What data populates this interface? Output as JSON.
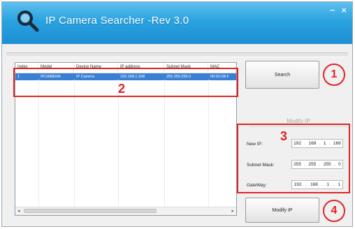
{
  "window": {
    "title": "IP Camera Searcher -Rev 3.0",
    "minimize_label": "−",
    "close_label": "×"
  },
  "list": {
    "columns": [
      "Index",
      "Model",
      "Device Name",
      "IP address",
      "Subnet Mask",
      "MAC"
    ],
    "rows": [
      [
        "1",
        "IPCAMERA",
        "IP Camera",
        "192.168.1.168",
        "255.255.255.0",
        "00:00:1B:F"
      ]
    ]
  },
  "search_button": "Search",
  "modify_group": {
    "title": "Modify IP",
    "new_ip_label": "New IP:",
    "subnet_label": "Subnet Mask:",
    "gateway_label": "GateWay:",
    "new_ip": [
      "192",
      "168",
      "1",
      "168"
    ],
    "subnet": [
      "255",
      "255",
      "255",
      "0"
    ],
    "gateway": [
      "192",
      "168",
      "1",
      "1"
    ]
  },
  "modify_button": "Modify IP",
  "annotations": {
    "m1": "1",
    "m2": "2",
    "m3": "3",
    "m4": "4"
  },
  "colors": {
    "titlebar": "#2aa2e0",
    "selection": "#3a7fd4",
    "annotation": "#e02424"
  }
}
